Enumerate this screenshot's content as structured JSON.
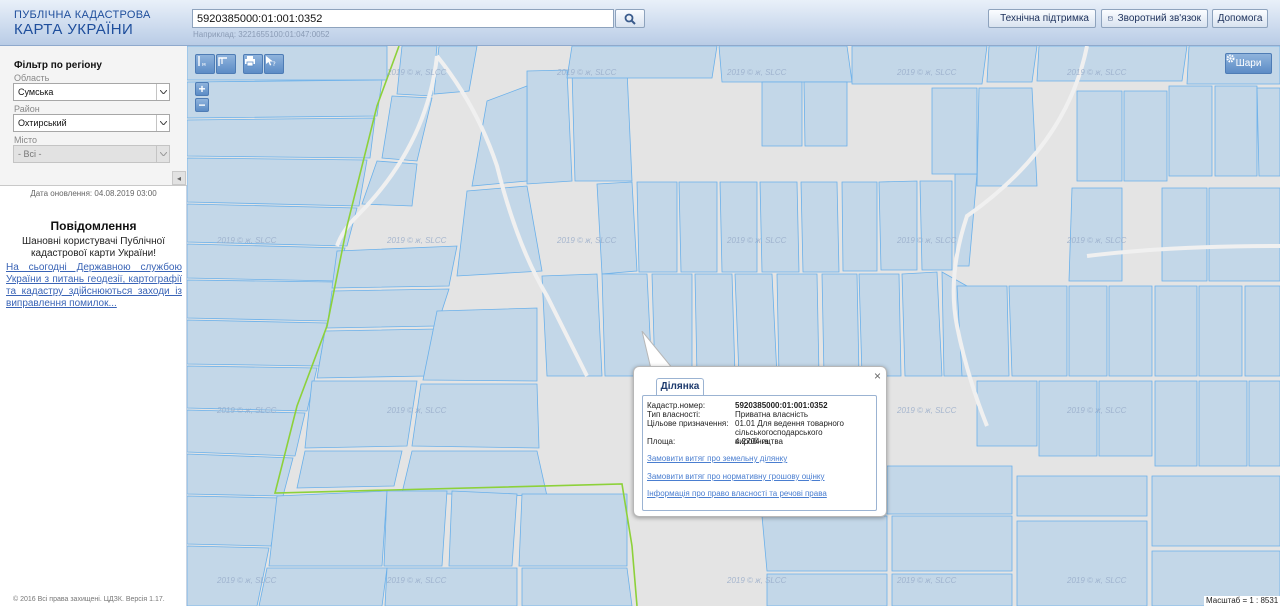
{
  "header": {
    "logo_line1": "ПУБЛІЧНА КАДАСТРОВА",
    "logo_line2": "КАРТА УКРАЇНИ",
    "search_value": "5920385000:01:001:0352",
    "search_hint": "Наприклад: 3221655100:01:047:0052",
    "buttons": [
      {
        "label": "Технічна підтримка",
        "icon": "tools-icon"
      },
      {
        "label": "Зворотний зв'язок",
        "icon": "envelope-icon"
      },
      {
        "label": "Допомога",
        "icon": ""
      }
    ]
  },
  "sidebar": {
    "filter_title": "Фільтр по регіону",
    "region_label": "Область",
    "region_value": "Сумська",
    "district_label": "Район",
    "district_value": "Охтирський",
    "city_label": "Місто",
    "city_value": "- Всі -",
    "updated": "Дата оновлення: 04.08.2019 03:00",
    "news_title": "Повідомлення",
    "news_text": "Шановні користувачі Публічної кадастрової карти України!",
    "news_link": "На сьогодні Державною службою України з питань геодезії, картографії та кадастру здійснюються заходи із виправлення помилок...",
    "copyright": "© 2016 Всі права захищені. ЦДЗК. Версія 1.17."
  },
  "map": {
    "layers_label": "Шари",
    "scale_label": "Масштаб = 1 : 8531",
    "watermark": "2019 © ж, SLCC",
    "colors": {
      "parcel_fill": "#c3d7e8",
      "parcel_stroke": "#6ab0ea",
      "boundary": "#8dd13a",
      "background": "#e4e4e4"
    }
  },
  "popup": {
    "tab": "Ділянка",
    "rows": [
      {
        "key": "Кадастр.номер:",
        "value": "5920385000:01:001:0352"
      },
      {
        "key": "Тип власності:",
        "value": "Приватна власність"
      },
      {
        "key": "Цільове призначення:",
        "value": "01.01 Для ведення товарного сільськогосподарського виробництва"
      },
      {
        "key": "Площа:",
        "value": "4.2704 га"
      }
    ],
    "links": [
      "Замовити витяг про земельну ділянку",
      "Замовити витяг про нормативну грошову оцінку",
      "Інформація про право власності та речові права"
    ]
  }
}
